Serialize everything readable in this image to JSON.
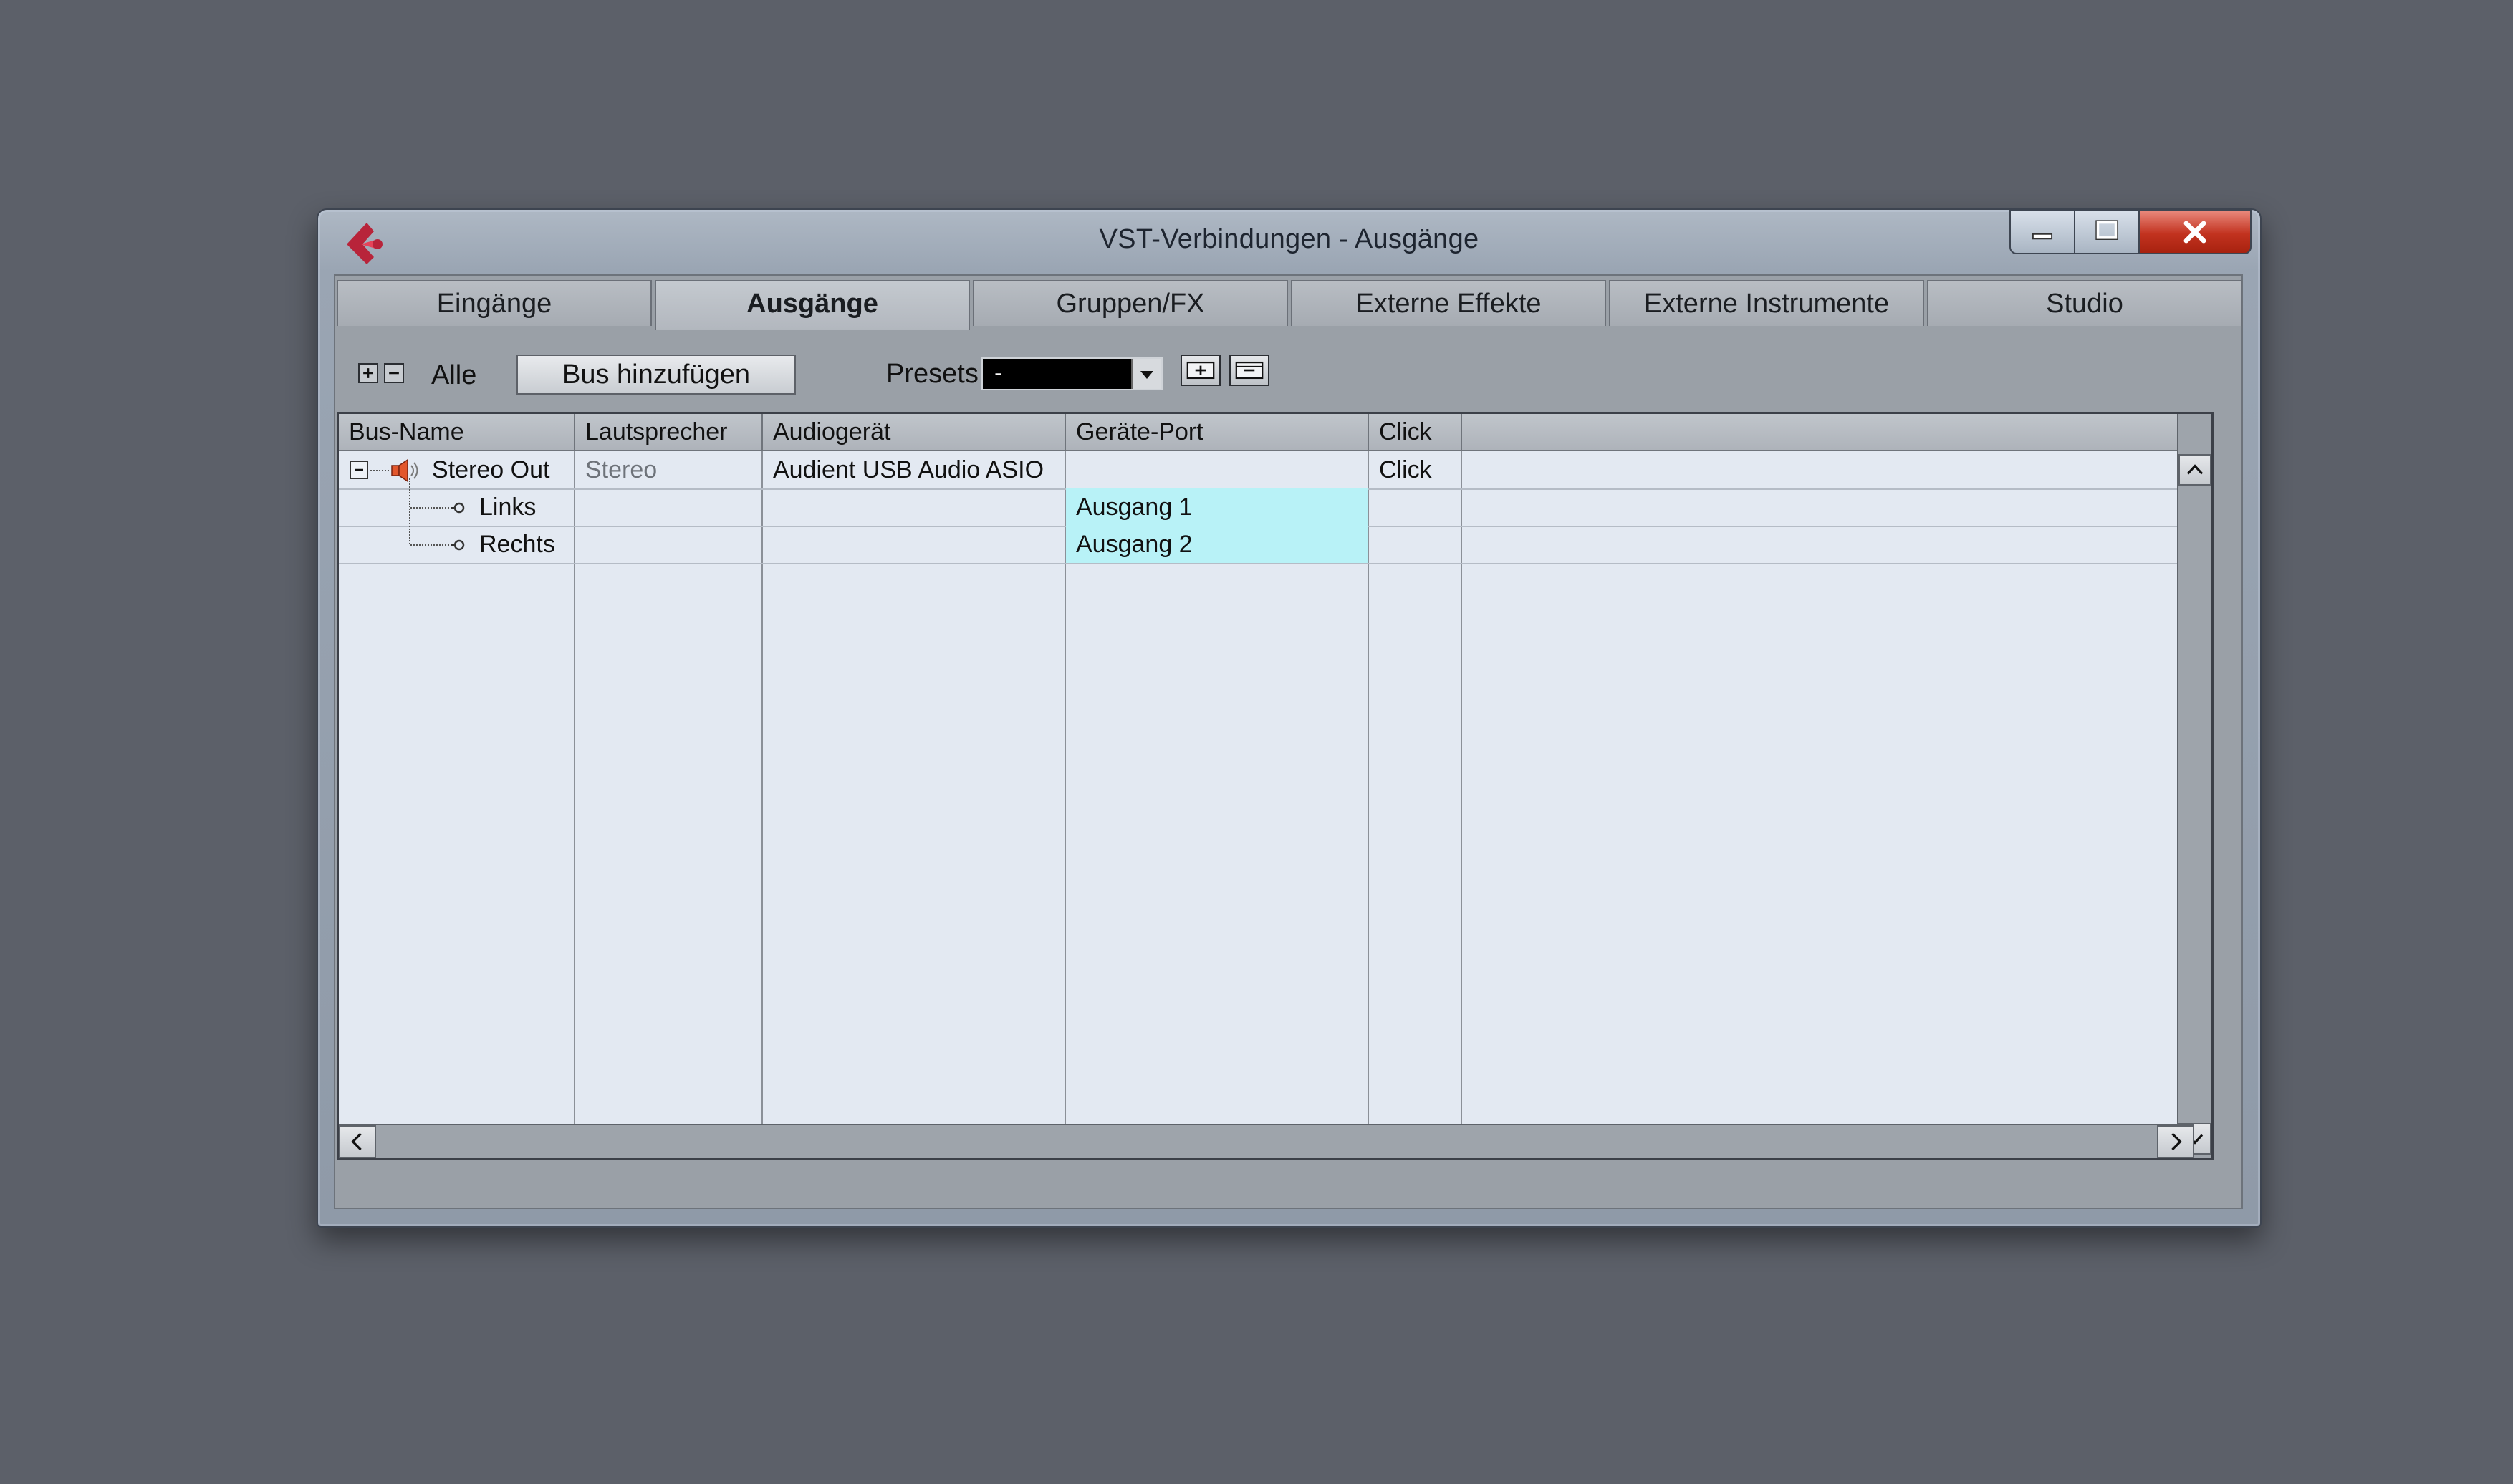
{
  "window": {
    "title": "VST-Verbindungen - Ausgänge"
  },
  "tabs": [
    {
      "label": "Eingänge",
      "active": false
    },
    {
      "label": "Ausgänge",
      "active": true
    },
    {
      "label": "Gruppen/FX",
      "active": false
    },
    {
      "label": "Externe Effekte",
      "active": false
    },
    {
      "label": "Externe Instrumente",
      "active": false
    },
    {
      "label": "Studio",
      "active": false
    }
  ],
  "toolbar": {
    "alle_label": "Alle",
    "add_bus_label": "Bus hinzufügen",
    "presets_label": "Presets",
    "presets_value": "-"
  },
  "table": {
    "columns": [
      "Bus-Name",
      "Lautsprecher",
      "Audiogerät",
      "Geräte-Port",
      "Click"
    ],
    "rows": [
      {
        "bus_name": "Stereo Out",
        "lautsprecher": "Stereo",
        "audiogeraet": "Audient USB Audio ASIO",
        "port": "",
        "click": "Click"
      },
      {
        "bus_name": "Links",
        "lautsprecher": "",
        "audiogeraet": "",
        "port": "Ausgang 1",
        "click": ""
      },
      {
        "bus_name": "Rechts",
        "lautsprecher": "",
        "audiogeraet": "",
        "port": "Ausgang 2",
        "click": ""
      }
    ]
  },
  "colors": {
    "port_highlight": "#b8f2f7",
    "close_button": "#c2321f",
    "speaker_icon": "#e2572c"
  }
}
